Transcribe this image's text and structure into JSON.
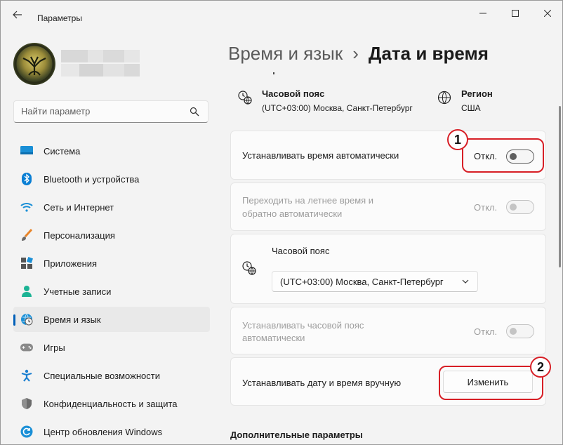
{
  "window": {
    "title": "Параметры",
    "back_icon": "back-arrow-icon",
    "minimize_icon": "minimize-icon",
    "maximize_icon": "maximize-icon",
    "close_icon": "close-icon"
  },
  "profile": {
    "avatar_icon": "tree-avatar"
  },
  "search": {
    "placeholder": "Найти параметр",
    "icon": "search-icon"
  },
  "sidebar": {
    "items": [
      {
        "label": "Система",
        "icon": "system-icon",
        "active": false
      },
      {
        "label": "Bluetooth и устройства",
        "icon": "bluetooth-icon",
        "active": false
      },
      {
        "label": "Сеть и Интернет",
        "icon": "wifi-icon",
        "active": false
      },
      {
        "label": "Персонализация",
        "icon": "brush-icon",
        "active": false
      },
      {
        "label": "Приложения",
        "icon": "apps-icon",
        "active": false
      },
      {
        "label": "Учетные записи",
        "icon": "account-icon",
        "active": false
      },
      {
        "label": "Время и язык",
        "icon": "time-language-icon",
        "active": true
      },
      {
        "label": "Игры",
        "icon": "gamepad-icon",
        "active": false
      },
      {
        "label": "Специальные возможности",
        "icon": "accessibility-icon",
        "active": false
      },
      {
        "label": "Конфиденциальность и защита",
        "icon": "shield-icon",
        "active": false
      },
      {
        "label": "Центр обновления Windows",
        "icon": "update-icon",
        "active": false
      }
    ]
  },
  "breadcrumb": {
    "parent": "Время и язык",
    "separator": "›",
    "current": "Дата и время"
  },
  "info": {
    "timezone": {
      "title": "Часовой пояс",
      "value": "(UTC+03:00) Москва, Санкт-Петербург",
      "icon": "globe-clock-icon"
    },
    "region": {
      "title": "Регион",
      "value": "США",
      "icon": "globe-icon"
    }
  },
  "settings": {
    "auto_time": {
      "label": "Устанавливать время автоматически",
      "state": "Откл.",
      "on": false,
      "enabled": true
    },
    "dst": {
      "label_line1": "Переходить на летнее время и",
      "label_line2": "обратно автоматически",
      "state": "Откл.",
      "on": false,
      "enabled": false
    },
    "timezone_select": {
      "label": "Часовой пояс",
      "selected": "(UTC+03:00) Москва, Санкт-Петербург",
      "icon": "globe-clock-icon"
    },
    "auto_timezone": {
      "label_line1": "Устанавливать часовой пояс",
      "label_line2": "автоматически",
      "state": "Откл.",
      "on": false,
      "enabled": false
    },
    "manual_datetime": {
      "label": "Устанавливать дату и время вручную",
      "button": "Изменить"
    }
  },
  "annotations": {
    "badge1": "1",
    "badge2": "2",
    "color": "#d71f26"
  },
  "more": {
    "heading": "Дополнительные параметры"
  },
  "colors": {
    "accent": "#005fb8",
    "annotation_red": "#d71f26"
  }
}
